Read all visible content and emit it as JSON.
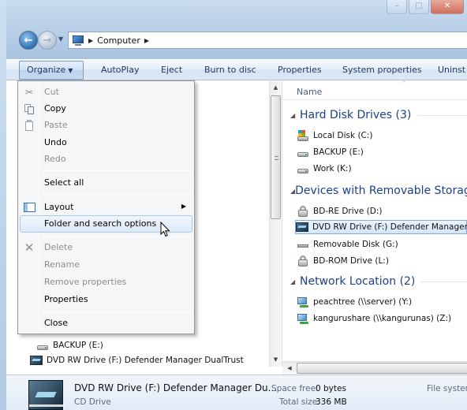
{
  "address": {
    "segments": [
      "Computer"
    ]
  },
  "command_bar": {
    "organize": "Organize",
    "autoplay": "AutoPlay",
    "eject": "Eject",
    "burn": "Burn to disc",
    "properties": "Properties",
    "system_properties": "System properties",
    "uninstall": "Uninst"
  },
  "menu": {
    "cut": "Cut",
    "copy": "Copy",
    "paste": "Paste",
    "undo": "Undo",
    "redo": "Redo",
    "select_all": "Select all",
    "layout": "Layout",
    "folder_options": "Folder and search options",
    "delete": "Delete",
    "rename": "Rename",
    "remove_properties": "Remove properties",
    "properties": "Properties",
    "close": "Close"
  },
  "content": {
    "column_name": "Name",
    "hard_disk_group": "Hard Disk Drives (3)",
    "hard_disks": [
      "Local Disk (C:)",
      "BACKUP (E:)",
      "Work (K:)"
    ],
    "removable_group": "Devices with Removable Storage",
    "removable": [
      "BD-RE Drive (D:)",
      "DVD RW Drive (F:) Defender Manager",
      "Removable Disk (G:)",
      "BD-ROM Drive (L:)"
    ],
    "network_group": "Network Location (2)",
    "network": [
      "peachtree (\\\\server) (Y:)",
      "kangurushare (\\\\kangurunas) (Z:)"
    ]
  },
  "nav_pane": {
    "items": [
      "BACKUP (E:)",
      "DVD RW Drive (F:) Defender Manager DualTrust"
    ]
  },
  "details": {
    "name": "DVD RW Drive (F:) Defender Manager Du...",
    "type": "CD Drive",
    "space_free_label": "Space free:",
    "space_free_value": "0 bytes",
    "total_size_label": "Total size:",
    "total_size_value": "336 MB",
    "filesystem_label": "File syster"
  },
  "colors": {
    "group_title": "#1e3f8a",
    "selection_border": "#84acdd",
    "menu_hover_border": "#a8c8ec"
  }
}
